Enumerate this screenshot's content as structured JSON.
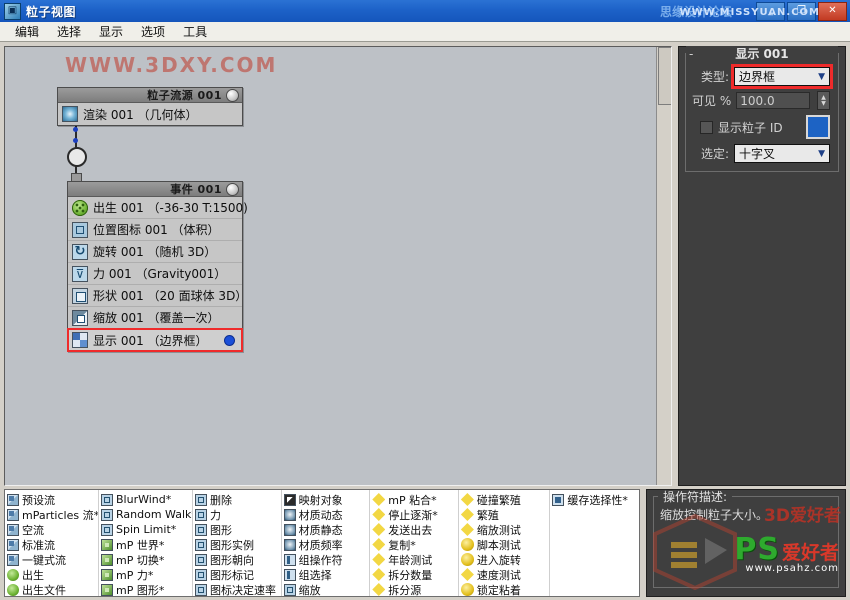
{
  "window": {
    "title": "粒子视图",
    "icon": "app-icon",
    "buttons": [
      {
        "name": "minimize",
        "glyph": "_"
      },
      {
        "name": "maximize",
        "glyph": "❐"
      },
      {
        "name": "close",
        "glyph": "✕"
      }
    ],
    "watermark_forum": "思缘设计论坛",
    "watermark_url": "WWW.MISSYUAN.COM"
  },
  "menubar": {
    "items": [
      "编辑",
      "选择",
      "显示",
      "选项",
      "工具"
    ]
  },
  "canvas": {
    "watermark": "WWW.3DXY.COM",
    "source_node": {
      "header_title": "粒子流源 001",
      "rows": [
        {
          "icon": "render-icon",
          "label": "渲染 001 （几何体）"
        }
      ]
    },
    "event_node": {
      "header_title": "事件 001",
      "rows": [
        {
          "icon": "birth-icon",
          "label": "出生 001 （-36-30 T:1500)",
          "selected": false,
          "dot": false
        },
        {
          "icon": "position-icon",
          "label": "位置图标 001 （体积）",
          "selected": false,
          "dot": false
        },
        {
          "icon": "rotate-icon",
          "label": "旋转 001 （随机 3D）",
          "selected": false,
          "dot": false
        },
        {
          "icon": "force-icon",
          "label": "力 001 （Gravity001）",
          "selected": false,
          "dot": false
        },
        {
          "icon": "shape-icon",
          "label": "形状 001 （20 面球体 3D）",
          "selected": false,
          "dot": false
        },
        {
          "icon": "scale-icon",
          "label": "缩放 001 （覆盖一次）",
          "selected": false,
          "dot": false
        },
        {
          "icon": "display-icon",
          "label": "显示 001 （边界框）",
          "selected": true,
          "dot": true
        }
      ]
    }
  },
  "panel": {
    "rollout_title": "显示 001",
    "collapse_glyph": "-",
    "type_label": "类型:",
    "type_value": "边界框",
    "visible_label": "可见 %",
    "visible_value": "100.0",
    "particle_id_label": "显示粒子 ID",
    "particle_id_checked": false,
    "color_swatch": "#1d63c4",
    "selected_label": "选定:",
    "selected_value": "十字叉",
    "highlight_color": "#ef2b2b"
  },
  "depot": {
    "columns": [
      {
        "name": "flows",
        "items": [
          {
            "icon": "flow-icon",
            "label": "预设流"
          },
          {
            "icon": "flow-icon",
            "label": "mParticles 流*"
          },
          {
            "icon": "flow-icon",
            "label": "空流"
          },
          {
            "icon": "flow-icon",
            "label": "标准流"
          },
          {
            "icon": "flow-icon",
            "label": "一键式流"
          },
          {
            "icon": "birth-icon",
            "label": "出生"
          },
          {
            "icon": "birth-icon",
            "label": "出生文件"
          }
        ]
      },
      {
        "name": "operators-a",
        "items": [
          {
            "icon": "force-icon",
            "label": "BlurWind*"
          },
          {
            "icon": "walk-icon",
            "label": "Random Walk*"
          },
          {
            "icon": "spin-icon",
            "label": "Spin Limit*"
          },
          {
            "icon": "mp-icon",
            "label": "mP 世界*"
          },
          {
            "icon": "mp-icon",
            "label": "mP 切换*"
          },
          {
            "icon": "mp-icon",
            "label": "mP 力*"
          },
          {
            "icon": "mp-icon",
            "label": "mP 图形*"
          }
        ]
      },
      {
        "name": "operators-b",
        "items": [
          {
            "icon": "delete-icon",
            "label": "删除"
          },
          {
            "icon": "force-icon",
            "label": "力"
          },
          {
            "icon": "shape-icon",
            "label": "图形"
          },
          {
            "icon": "shape-icon",
            "label": "图形实例"
          },
          {
            "icon": "shape-icon",
            "label": "图形朝向"
          },
          {
            "icon": "shape-icon",
            "label": "图形标记"
          },
          {
            "icon": "walk-icon",
            "label": "图标决定速率"
          }
        ]
      },
      {
        "name": "operators-c",
        "items": [
          {
            "icon": "mapping-icon",
            "label": "映射对象"
          },
          {
            "icon": "material-icon",
            "label": "材质动态"
          },
          {
            "icon": "material-icon",
            "label": "材质静态"
          },
          {
            "icon": "material-icon",
            "label": "材质频率"
          },
          {
            "icon": "group-icon",
            "label": "组操作符"
          },
          {
            "icon": "group-icon",
            "label": "组选择"
          },
          {
            "icon": "scale-icon",
            "label": "缩放"
          }
        ]
      },
      {
        "name": "tests-a",
        "items": [
          {
            "icon": "test-mp-icon",
            "label": "mP 粘合*"
          },
          {
            "icon": "test-icon",
            "label": "停止逐渐*"
          },
          {
            "icon": "test-icon",
            "label": "发送出去"
          },
          {
            "icon": "test-icon",
            "label": "复制*"
          },
          {
            "icon": "test-icon",
            "label": "年龄测试"
          },
          {
            "icon": "test-icon",
            "label": "拆分数量"
          },
          {
            "icon": "test-icon",
            "label": "拆分源"
          }
        ]
      },
      {
        "name": "tests-b",
        "items": [
          {
            "icon": "test-icon",
            "label": "碰撞繁殖"
          },
          {
            "icon": "test-icon",
            "label": "繁殖"
          },
          {
            "icon": "test-icon",
            "label": "缩放测试"
          },
          {
            "icon": "test-script-icon",
            "label": "脚本测试"
          },
          {
            "icon": "test-spin-icon",
            "label": "进入旋转"
          },
          {
            "icon": "test-icon",
            "label": "速度测试"
          },
          {
            "icon": "test-lock-icon",
            "label": "锁定粘着"
          }
        ]
      },
      {
        "name": "cache",
        "items": [
          {
            "icon": "cache-icon",
            "label": "缓存选择性*"
          }
        ]
      }
    ]
  },
  "description": {
    "title": "操作符描述:",
    "body": "缩放控制粒子大小。"
  },
  "watermarks": {
    "ps_big": "PS",
    "ps_cn": "爱好者",
    "ps_url": "www.psahz.com",
    "psahz_right": "3D爱好者"
  }
}
